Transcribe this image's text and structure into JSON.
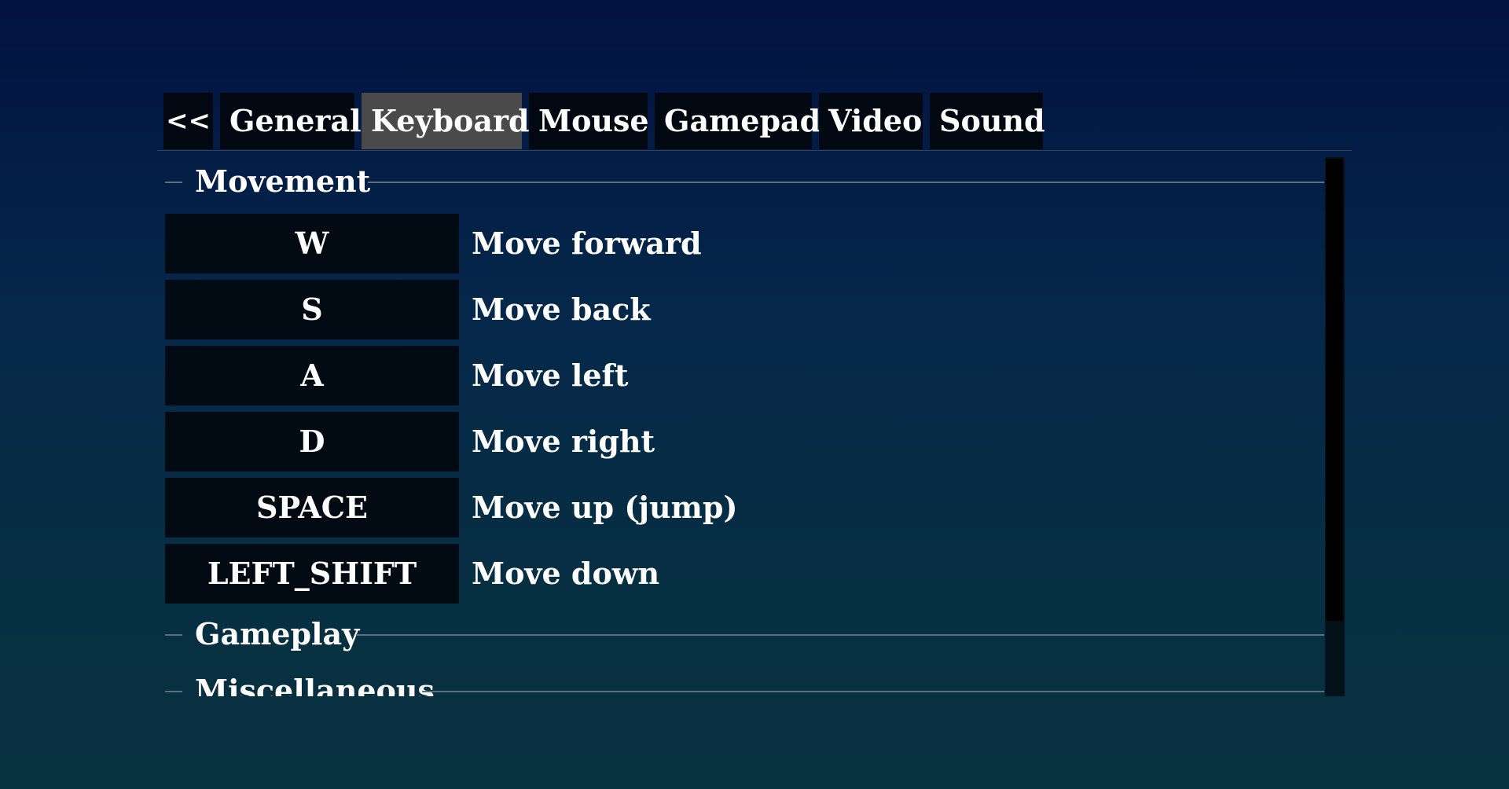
{
  "tabs": [
    {
      "label": "<<",
      "active": false
    },
    {
      "label": "General",
      "active": false
    },
    {
      "label": "Keyboard",
      "active": true
    },
    {
      "label": "Mouse",
      "active": false
    },
    {
      "label": "Gamepad",
      "active": false
    },
    {
      "label": "Video",
      "active": false
    },
    {
      "label": "Sound",
      "active": false
    }
  ],
  "sections": {
    "movement": {
      "title": "Movement",
      "bindings": [
        {
          "key": "W",
          "action": "Move forward"
        },
        {
          "key": "S",
          "action": "Move back"
        },
        {
          "key": "A",
          "action": "Move left"
        },
        {
          "key": "D",
          "action": "Move right"
        },
        {
          "key": "SPACE",
          "action": "Move up (jump)"
        },
        {
          "key": "LEFT_SHIFT",
          "action": "Move down"
        }
      ]
    },
    "gameplay": {
      "title": "Gameplay"
    },
    "miscellaneous": {
      "title": "Miscellaneous"
    }
  },
  "colors": {
    "active_tab": "#4a4a4a",
    "tab_background": "#020812",
    "key_button_background": "#020b14"
  }
}
